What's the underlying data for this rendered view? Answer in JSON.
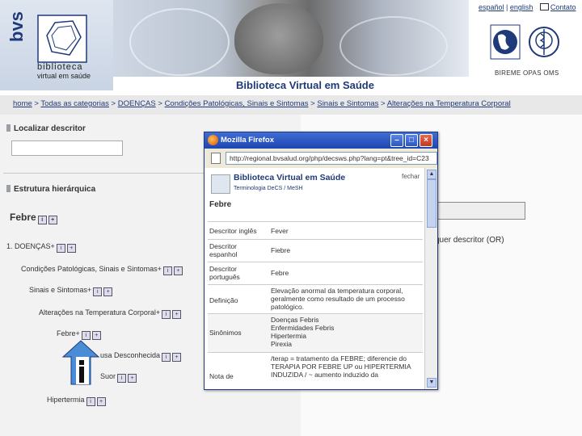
{
  "header": {
    "logo": {
      "mark": "bvs",
      "line1": "biblioteca",
      "line2": "virtual em saúde"
    },
    "site_title": "Biblioteca Virtual em Saúde",
    "top_links": {
      "espanol": "español",
      "english": "english",
      "contato": "Contato"
    },
    "org_label": "BIREME OPAS OMS"
  },
  "breadcrumb": [
    {
      "label": "home"
    },
    {
      "label": "Todas as categorias"
    },
    {
      "label": "DOENÇAS"
    },
    {
      "label": "Condições Patológicas, Sinais e Sintomas"
    },
    {
      "label": "Sinais e Sintomas"
    },
    {
      "label": "Alterações na Temperatura Corporal"
    }
  ],
  "left": {
    "locate_title": "Localizar descritor",
    "hierarchy_title": "Estrutura hierárquica",
    "current_term": "Febre",
    "tree": [
      {
        "label": "1. DOENÇAS+"
      },
      {
        "label": "Condições Patológicas, Sinais e Sintomas+"
      },
      {
        "label": "Sinais e Sintomas+"
      },
      {
        "label": "Alterações na Temperatura Corporal+"
      },
      {
        "label": "Febre+"
      },
      {
        "label": "usa Desconhecida"
      },
      {
        "label": "Suor"
      },
      {
        "label": "Hipertermia"
      }
    ]
  },
  "right": {
    "hint": "quer descritor (OR)"
  },
  "popup": {
    "window_title": "Mozilla Firefox",
    "url": "http://regional.bvsalud.org/php/decsws.php?lang=pt&tree_id=C23",
    "site_title": "Biblioteca Virtual em Saúde",
    "subtitle": "Terminologia DeCS / MeSH",
    "close": "fechar",
    "term": "Febre",
    "rows": [
      {
        "key": "Descritor inglês",
        "value": "Fever"
      },
      {
        "key": "Descritor espanhol",
        "value": "Fiebre"
      },
      {
        "key": "Descritor português",
        "value": "Febre"
      },
      {
        "key": "Definição",
        "value": "Elevação anormal da temperatura corporal, geralmente como resultado de um processo patológico."
      },
      {
        "key": "Sinônimos",
        "value": "Doenças Febris\nEnfermidades Febris\nHipertermia\nPirexia"
      },
      {
        "key": "Nota de",
        "value": "/terap = tratamento da FEBRE; diferencie do TERAPIA POR FEBRE UP ou HIPERTERMIA INDUZIDA / ~ aumento induzido da"
      }
    ]
  },
  "colors": {
    "brand_blue": "#1f3a78",
    "titlebar": "#1d46b0"
  }
}
